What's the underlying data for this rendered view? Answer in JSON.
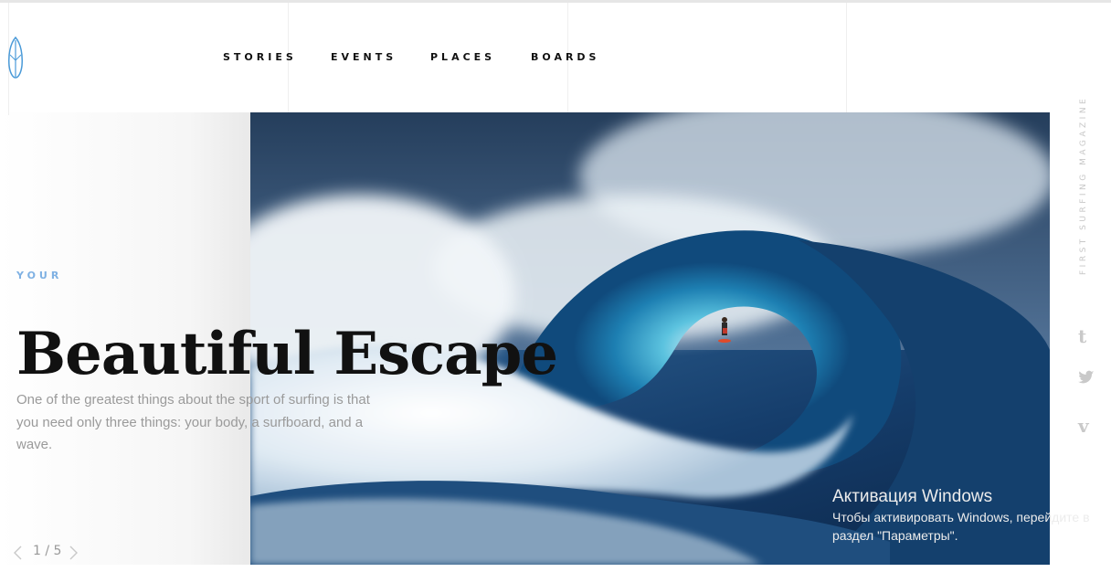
{
  "nav": {
    "items": [
      "STORIES",
      "EVENTS",
      "PLACES",
      "BOARDS"
    ]
  },
  "hero": {
    "eyebrow": "YOUR",
    "title": "Beautiful Escape",
    "description": "One of the greatest things about the sport of surfing is that you need only three things: your body, a surfboard, and a wave."
  },
  "pager": {
    "current": "1 / 5"
  },
  "side": {
    "tagline": "FIRST SURFING MAGAZINE",
    "social": [
      "tumblr-icon",
      "twitter-icon",
      "vimeo-icon"
    ]
  },
  "watermark": {
    "title": "Активация Windows",
    "line1": "Чтобы активировать Windows, перейдите в",
    "line2": "раздел \"Параметры\"."
  },
  "colors": {
    "accent": "#7fb1e3",
    "logo": "#4a9ad8"
  }
}
